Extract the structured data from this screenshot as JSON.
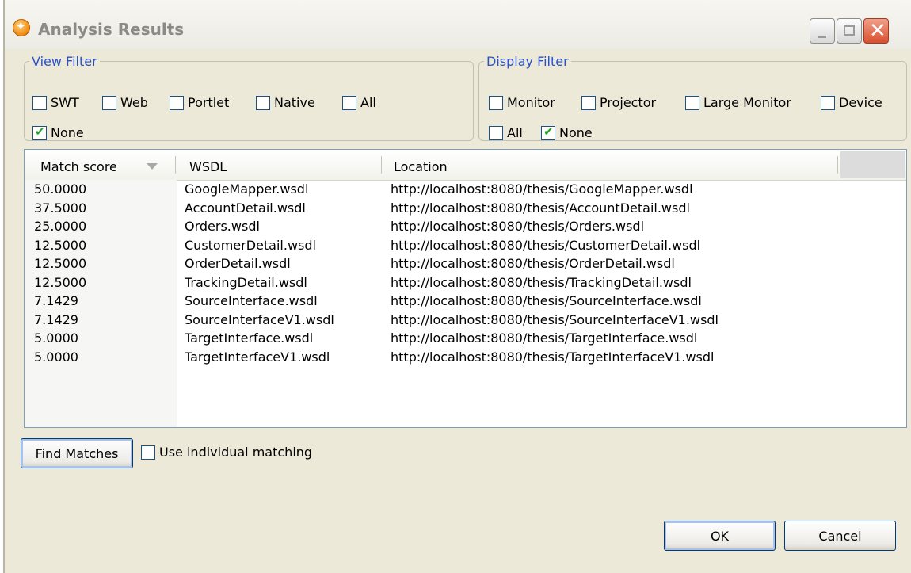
{
  "window": {
    "title": "Analysis Results"
  },
  "view_filter": {
    "legend": "View Filter",
    "options": [
      {
        "label": "SWT",
        "checked": false
      },
      {
        "label": "Web",
        "checked": false
      },
      {
        "label": "Portlet",
        "checked": false
      },
      {
        "label": "Native",
        "checked": false
      },
      {
        "label": "All",
        "checked": false
      },
      {
        "label": "None",
        "checked": true
      }
    ]
  },
  "display_filter": {
    "legend": "Display Filter",
    "options": [
      {
        "label": "Monitor",
        "checked": false
      },
      {
        "label": "Projector",
        "checked": false
      },
      {
        "label": "Large Monitor",
        "checked": false
      },
      {
        "label": "Device",
        "checked": false
      },
      {
        "label": "All",
        "checked": false
      },
      {
        "label": "None",
        "checked": true
      }
    ]
  },
  "table": {
    "columns": [
      "Match score",
      "WSDL",
      "Location"
    ],
    "rows": [
      [
        "50.0000",
        "GoogleMapper.wsdl",
        "http://localhost:8080/thesis/GoogleMapper.wsdl"
      ],
      [
        "37.5000",
        "AccountDetail.wsdl",
        "http://localhost:8080/thesis/AccountDetail.wsdl"
      ],
      [
        "25.0000",
        "Orders.wsdl",
        "http://localhost:8080/thesis/Orders.wsdl"
      ],
      [
        "12.5000",
        "CustomerDetail.wsdl",
        "http://localhost:8080/thesis/CustomerDetail.wsdl"
      ],
      [
        "12.5000",
        "OrderDetail.wsdl",
        "http://localhost:8080/thesis/OrderDetail.wsdl"
      ],
      [
        "12.5000",
        "TrackingDetail.wsdl",
        "http://localhost:8080/thesis/TrackingDetail.wsdl"
      ],
      [
        "7.1429",
        "SourceInterface.wsdl",
        "http://localhost:8080/thesis/SourceInterface.wsdl"
      ],
      [
        "7.1429",
        "SourceInterfaceV1.wsdl",
        "http://localhost:8080/thesis/SourceInterfaceV1.wsdl"
      ],
      [
        "5.0000",
        "TargetInterface.wsdl",
        "http://localhost:8080/thesis/TargetInterface.wsdl"
      ],
      [
        "5.0000",
        "TargetInterfaceV1.wsdl",
        "http://localhost:8080/thesis/TargetInterfaceV1.wsdl"
      ]
    ]
  },
  "actions": {
    "find_matches": "Find Matches",
    "individual_matching": {
      "label": "Use individual matching",
      "checked": false
    },
    "ok": "OK",
    "cancel": "Cancel"
  }
}
